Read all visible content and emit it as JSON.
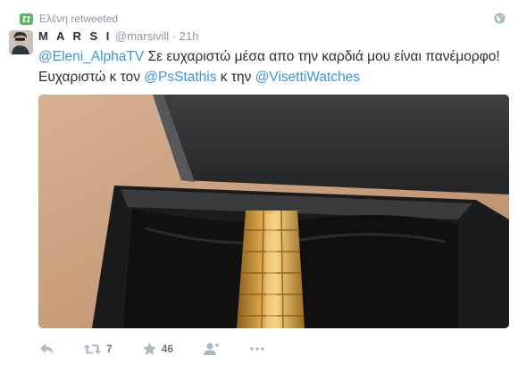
{
  "context": {
    "text": "Ελένη retweeted"
  },
  "tweet": {
    "fullname": "M A R S I",
    "handle": "@marsivill",
    "separator": "·",
    "time": "21h",
    "text_parts": {
      "mention1": "@Eleni_AlphaTV",
      "text1": " Σε ευχαριστώ μέσα απο την καρδιά μου είναι πανέμορφο!Ευχαριστώ κ τον ",
      "mention2": "@PsStathis",
      "text2": " κ την ",
      "mention3": "@VisettiWatches"
    }
  },
  "actions": {
    "retweet_count": "7",
    "like_count": "46"
  },
  "colors": {
    "link": "#3b94d9",
    "muted": "#8899a6",
    "action_icon": "#aab8c2",
    "retweet_badge": "#5ab564"
  },
  "icons": {
    "context": "retweet-badge-icon",
    "globe": "globe-icon",
    "reply": "reply-icon",
    "retweet": "retweet-icon",
    "like": "star-icon",
    "follow": "follow-icon"
  }
}
